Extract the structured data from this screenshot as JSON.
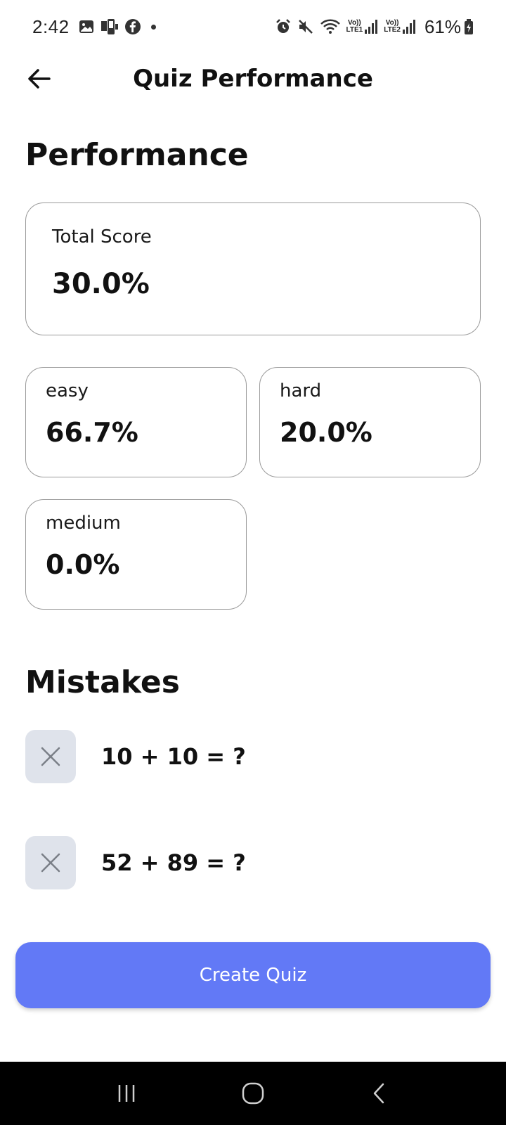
{
  "status_bar": {
    "time": "2:42",
    "network1_label_top": "Vo))",
    "network1_label_bottom": "LTE1",
    "network2_label_top": "Vo))",
    "network2_label_bottom": "LTE2",
    "battery": "61%",
    "left_icons": [
      "gallery-icon",
      "sim-icon",
      "facebook-icon",
      "notification-dot"
    ],
    "right_icons": [
      "alarm-icon",
      "mute-icon",
      "wifi-icon",
      "signal-icon",
      "signal-icon",
      "battery-icon"
    ]
  },
  "app_bar": {
    "title": "Quiz Performance",
    "back_icon": "arrow-left-icon"
  },
  "performance": {
    "heading": "Performance",
    "total": {
      "label": "Total Score",
      "value": "30.0%"
    },
    "difficulties": [
      {
        "label": "easy",
        "value": "66.7%"
      },
      {
        "label": "hard",
        "value": "20.0%"
      },
      {
        "label": "medium",
        "value": "0.0%"
      }
    ]
  },
  "mistakes": {
    "heading": "Mistakes",
    "items": [
      {
        "question": "10 + 10 = ?",
        "icon": "close-icon"
      },
      {
        "question": "52 + 89 = ?",
        "icon": "close-icon"
      }
    ]
  },
  "actions": {
    "create_quiz_label": "Create Quiz"
  },
  "colors": {
    "primary": "#6279f6",
    "mistake_icon_bg": "#dfe3eb",
    "card_border": "#9a9a9a",
    "nav_bg": "#000000"
  },
  "nav_bar": {
    "icons": [
      "recent-apps-icon",
      "home-icon",
      "back-icon"
    ]
  }
}
